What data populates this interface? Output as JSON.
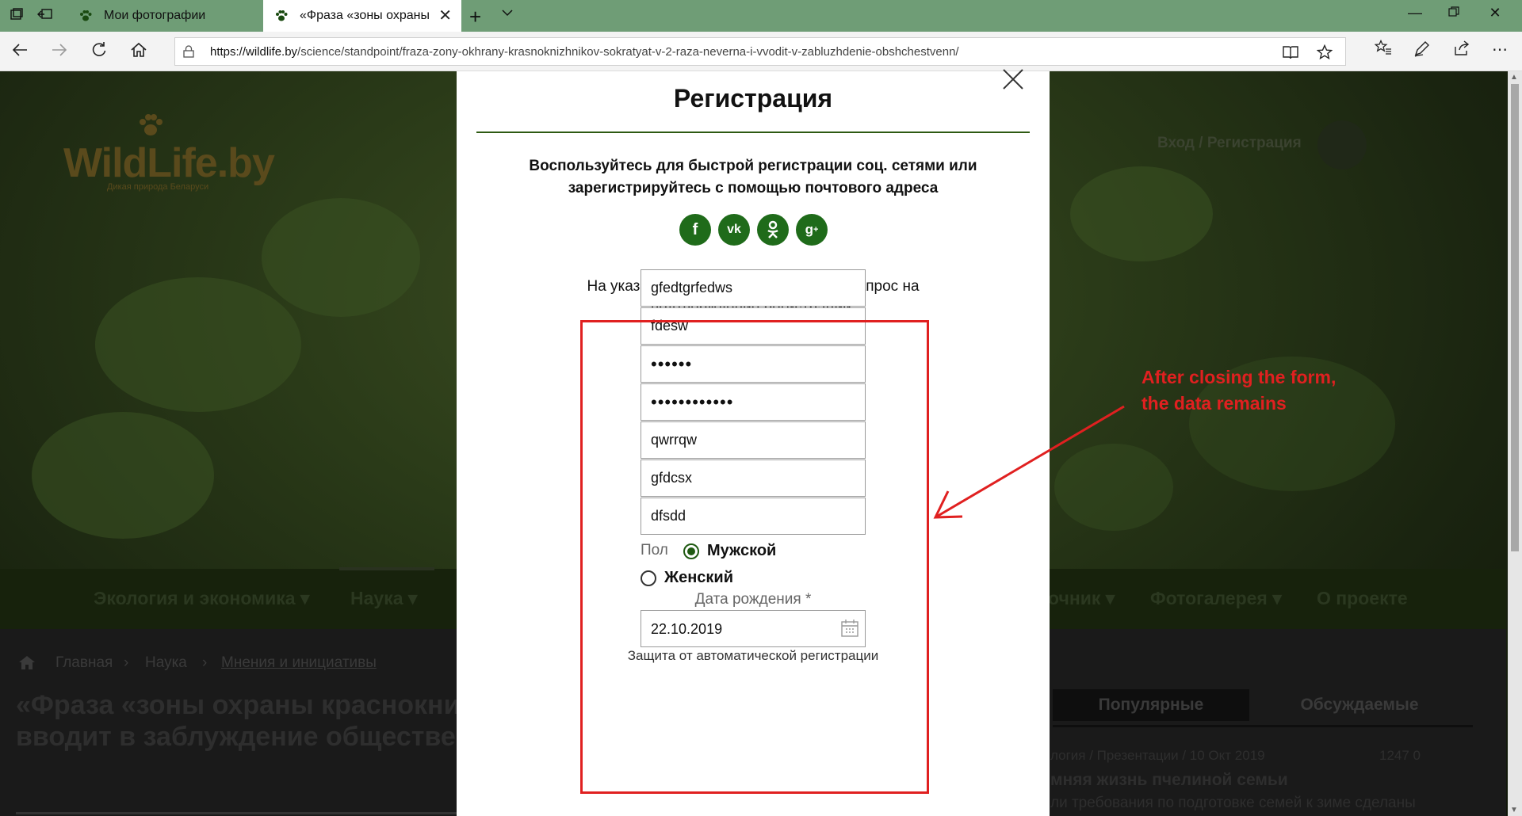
{
  "browser": {
    "tabs": [
      {
        "label": "Мои фотографии",
        "active": false
      },
      {
        "label": "«Фраза «зоны охраны",
        "active": true
      }
    ],
    "url_host": "https://wildlife.by",
    "url_path": "/science/standpoint/fraza-zony-okhrany-krasnoknizhnikov-sokratyat-v-2-raza-neverna-i-vvodit-v-zabluzhdenie-obshchestvenn/",
    "accent_color": "#6f9d76"
  },
  "site": {
    "logo_text": "WildLife.by",
    "logo_sub": "Дикая природа Беларуси",
    "login_link": "Вход / Регистрация",
    "menu": [
      "Экология и экономика",
      "Наука",
      "очник",
      "Фотогалерея",
      "О проекте"
    ],
    "breadcrumb": [
      "Главная",
      "Наука",
      "Мнения и инициативы"
    ],
    "article_title_line1": "«Фраза «зоны охраны краснокни",
    "article_title_line2": "вводит в заблуждение обществе",
    "side_tabs": [
      "Популярные",
      "Обсуждаемые"
    ],
    "side_meta": "логия / Презентации / 10 Окт 2019",
    "side_stats": "1247   0",
    "side_headline": "мняя жизнь пчелиной семьи",
    "side_text": "ли требования по подготовке семей к зиме сделаны"
  },
  "modal": {
    "title": "Регистрация",
    "intro": "Воспользуйтесь для быстрой регистрации соц. сетями или зарегистрируйтесь с помощью почтового адреса",
    "socials": [
      "facebook-icon",
      "vk-icon",
      "odnoklassniki-icon",
      "google-plus-icon"
    ],
    "social_color": "#1f6b1a",
    "note": "На указанный в форме e-mail придет запрос на подтверждение регистрации.",
    "fields": {
      "login": "gfedtgrfedws",
      "email": "fdesw",
      "password": "••••••",
      "password_confirm": "••••••••••••",
      "first_name": "qwrrqw",
      "last_name": "gfdcsx",
      "city": "dfsdd"
    },
    "gender_label": "Пол",
    "gender_options": [
      "Мужской",
      "Женский"
    ],
    "gender_selected": "Мужской",
    "dob_label": "Дата рождения *",
    "dob_value": "22.10.2019",
    "captcha_label": "Защита от автоматической регистрации"
  },
  "annotation": {
    "line1": "After closing the form,",
    "line2": "the data remains",
    "color": "#e02020"
  }
}
